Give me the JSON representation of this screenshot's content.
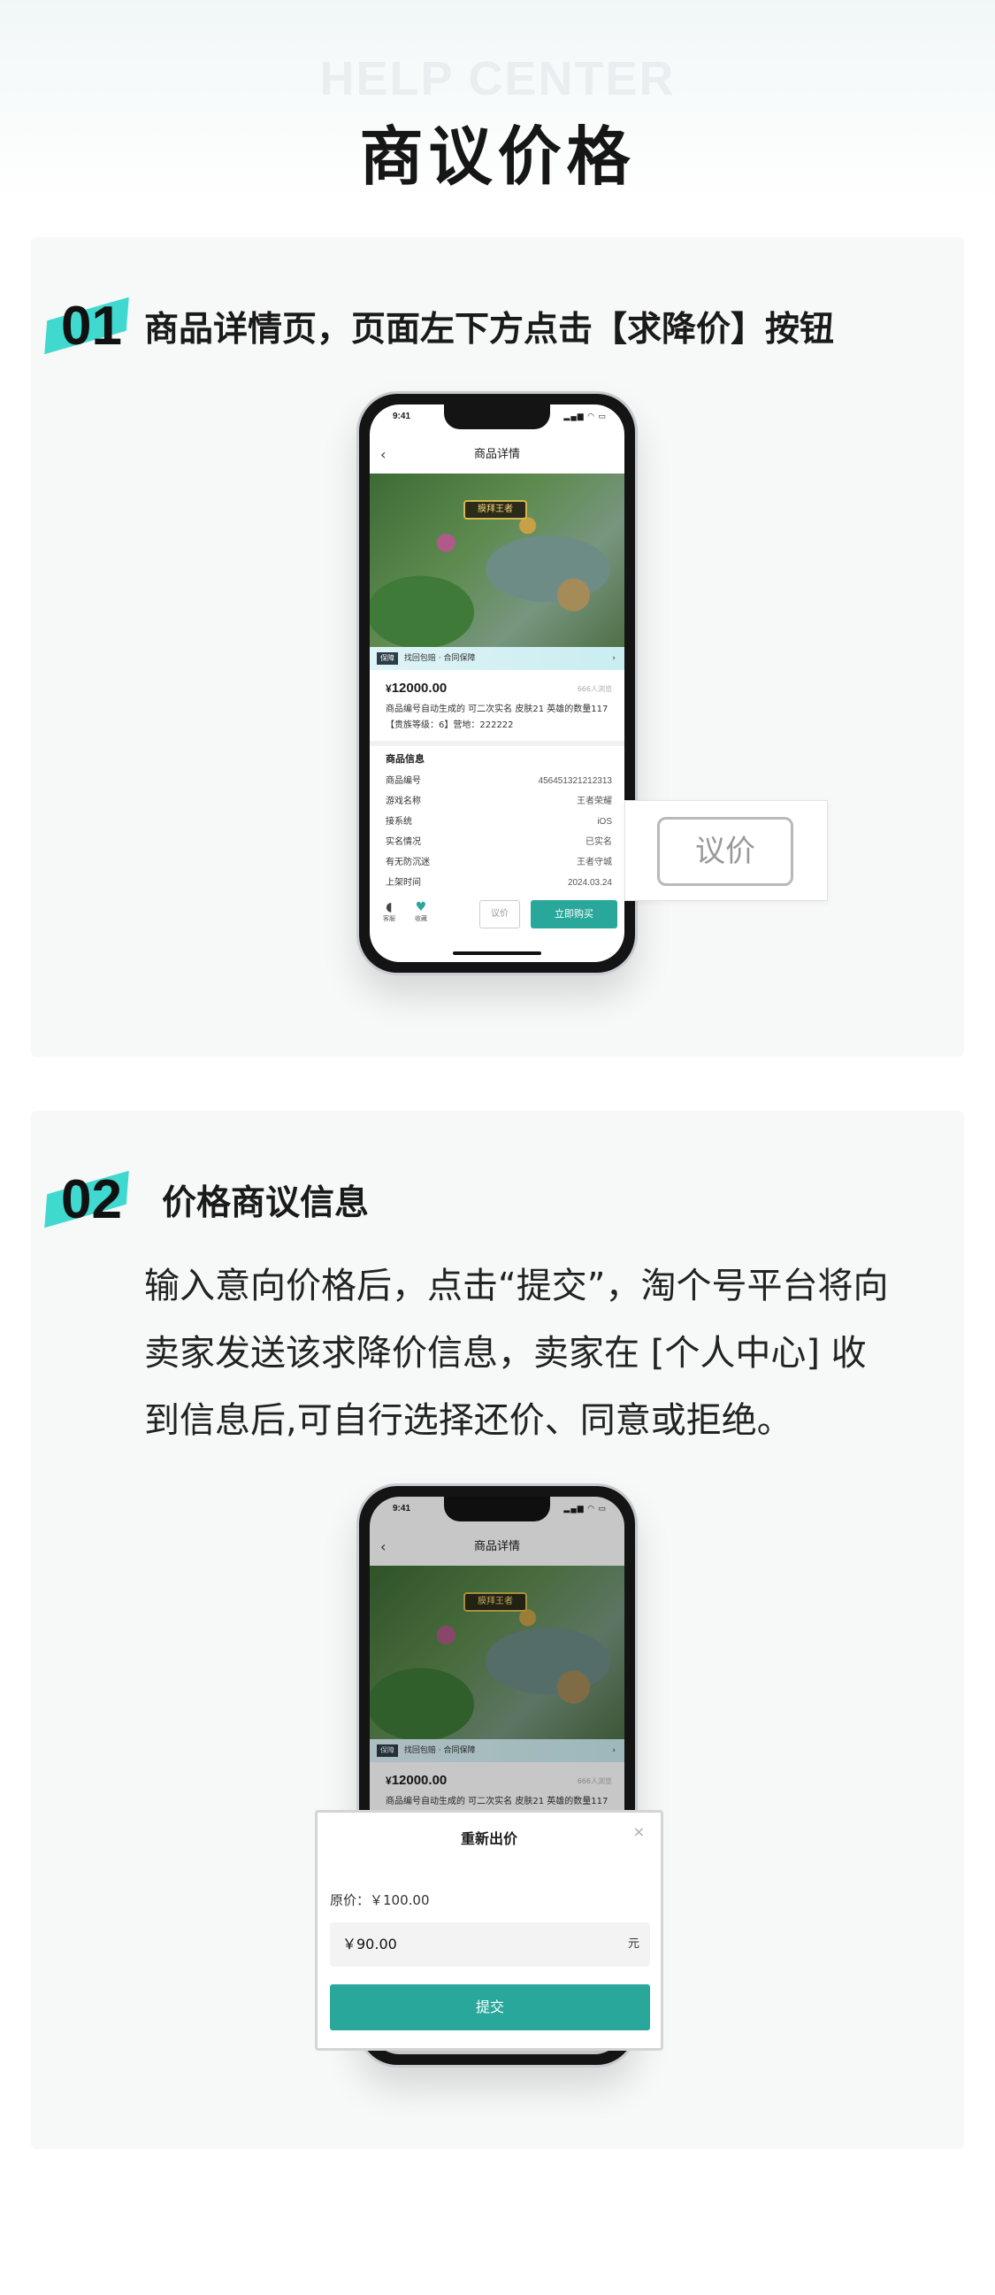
{
  "header": {
    "watermark": "HELP CENTER",
    "title": "商议价格"
  },
  "step1": {
    "number": "01",
    "title": "商品详情页，页面左下方点击【求降价】按钮",
    "callout_label": "议价"
  },
  "step2": {
    "number": "02",
    "title": "价格商议信息",
    "description_lines": [
      "输入意向价格后，点击“提交”，淘个号平台将向",
      "卖家发送该求降价信息，卖家在 [个人中心] 收",
      "到信息后,可自行选择还价、同意或拒绝。"
    ]
  },
  "phone": {
    "status_time": "9:41",
    "status_icons": "▂▄▆ ◠ ▭",
    "nav_title": "商品详情",
    "back_icon": "chevron-left-icon",
    "hero_banner": "膜拜王者",
    "guarantee_tag": "保障",
    "guarantee_text": "找回包赔 · 合同保障",
    "price_symbol": "¥",
    "price_value": "12000.00",
    "views": "666人浏览",
    "description": "商品编号自动生成的  可二次实名 皮肤21  英雄的数量117【贵族等级：6】营地：222222",
    "info_title": "商品信息",
    "info_rows": [
      {
        "label": "商品编号",
        "value": "456451321212313"
      },
      {
        "label": "游戏名称",
        "value": "王者荣耀"
      },
      {
        "label": "接系统",
        "value": "iOS"
      },
      {
        "label": "实名情况",
        "value": "已实名"
      },
      {
        "label": "有无防沉迷",
        "value": "王者守城"
      },
      {
        "label": "上架时间",
        "value": "2024.03.24"
      }
    ],
    "bottom": {
      "service_label": "客服",
      "favorite_label": "收藏",
      "bargain_label": "议价",
      "buy_label": "立即购买"
    }
  },
  "modal": {
    "title": "重新出价",
    "close_icon": "close-icon",
    "original_price": "原价：￥100.00",
    "input_value": "￥90.00",
    "unit": "元",
    "submit_label": "提交"
  },
  "colors": {
    "accent": "#2aa79b",
    "step_highlight": "#3fd9cf"
  }
}
